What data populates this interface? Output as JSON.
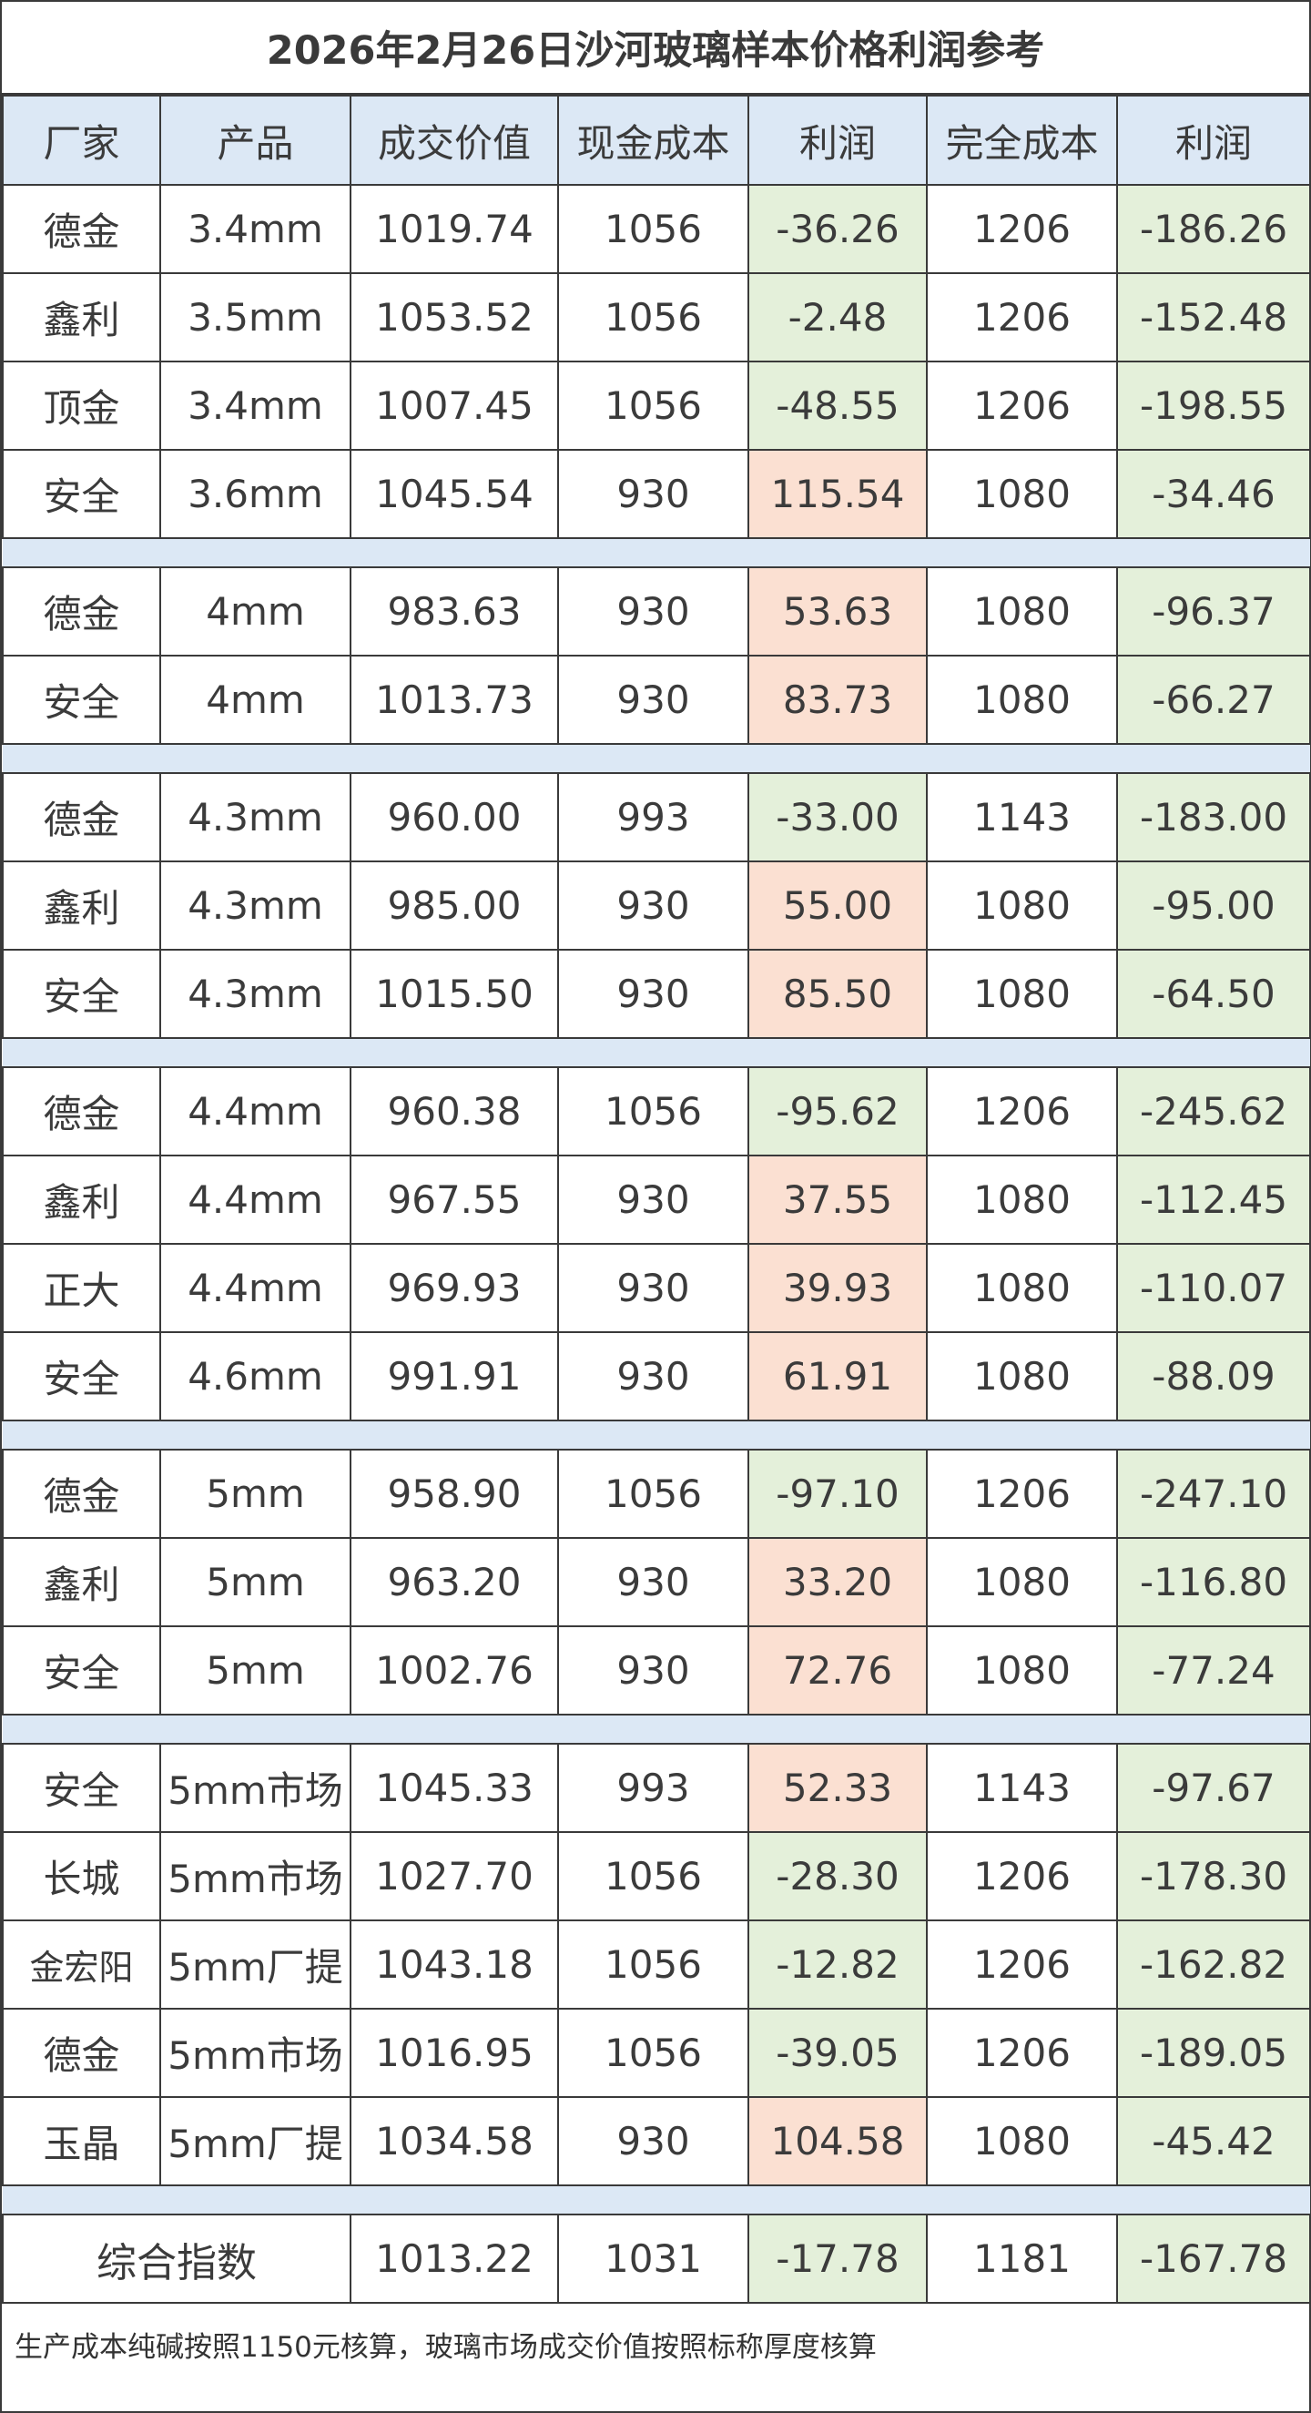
{
  "title": "2026年2月26日沙河玻璃样本价格利润参考",
  "headers": [
    "厂家",
    "产品",
    "成交价值",
    "现金成本",
    "利润",
    "完全成本",
    "利润"
  ],
  "groups": [
    {
      "rows": [
        {
          "factory": "德金",
          "product": "3.4mm",
          "deal_value": "1019.74",
          "cash_cost": "1056",
          "profit": "-36.26",
          "profit_sign": "neg",
          "full_cost": "1206",
          "full_profit": "-186.26"
        },
        {
          "factory": "鑫利",
          "product": "3.5mm",
          "deal_value": "1053.52",
          "cash_cost": "1056",
          "profit": "-2.48",
          "profit_sign": "neg",
          "full_cost": "1206",
          "full_profit": "-152.48"
        },
        {
          "factory": "顶金",
          "product": "3.4mm",
          "deal_value": "1007.45",
          "cash_cost": "1056",
          "profit": "-48.55",
          "profit_sign": "neg",
          "full_cost": "1206",
          "full_profit": "-198.55"
        },
        {
          "factory": "安全",
          "product": "3.6mm",
          "deal_value": "1045.54",
          "cash_cost": "930",
          "profit": "115.54",
          "profit_sign": "pos",
          "full_cost": "1080",
          "full_profit": "-34.46"
        }
      ]
    },
    {
      "rows": [
        {
          "factory": "德金",
          "product": "4mm",
          "deal_value": "983.63",
          "cash_cost": "930",
          "profit": "53.63",
          "profit_sign": "pos",
          "full_cost": "1080",
          "full_profit": "-96.37"
        },
        {
          "factory": "安全",
          "product": "4mm",
          "deal_value": "1013.73",
          "cash_cost": "930",
          "profit": "83.73",
          "profit_sign": "pos",
          "full_cost": "1080",
          "full_profit": "-66.27"
        }
      ]
    },
    {
      "rows": [
        {
          "factory": "德金",
          "product": "4.3mm",
          "deal_value": "960.00",
          "cash_cost": "993",
          "profit": "-33.00",
          "profit_sign": "neg",
          "full_cost": "1143",
          "full_profit": "-183.00"
        },
        {
          "factory": "鑫利",
          "product": "4.3mm",
          "deal_value": "985.00",
          "cash_cost": "930",
          "profit": "55.00",
          "profit_sign": "pos",
          "full_cost": "1080",
          "full_profit": "-95.00"
        },
        {
          "factory": "安全",
          "product": "4.3mm",
          "deal_value": "1015.50",
          "cash_cost": "930",
          "profit": "85.50",
          "profit_sign": "pos",
          "full_cost": "1080",
          "full_profit": "-64.50"
        }
      ]
    },
    {
      "rows": [
        {
          "factory": "德金",
          "product": "4.4mm",
          "deal_value": "960.38",
          "cash_cost": "1056",
          "profit": "-95.62",
          "profit_sign": "neg",
          "full_cost": "1206",
          "full_profit": "-245.62"
        },
        {
          "factory": "鑫利",
          "product": "4.4mm",
          "deal_value": "967.55",
          "cash_cost": "930",
          "profit": "37.55",
          "profit_sign": "pos",
          "full_cost": "1080",
          "full_profit": "-112.45"
        },
        {
          "factory": "正大",
          "product": "4.4mm",
          "deal_value": "969.93",
          "cash_cost": "930",
          "profit": "39.93",
          "profit_sign": "pos",
          "full_cost": "1080",
          "full_profit": "-110.07"
        },
        {
          "factory": "安全",
          "product": "4.6mm",
          "deal_value": "991.91",
          "cash_cost": "930",
          "profit": "61.91",
          "profit_sign": "pos",
          "full_cost": "1080",
          "full_profit": "-88.09"
        }
      ]
    },
    {
      "rows": [
        {
          "factory": "德金",
          "product": "5mm",
          "deal_value": "958.90",
          "cash_cost": "1056",
          "profit": "-97.10",
          "profit_sign": "neg",
          "full_cost": "1206",
          "full_profit": "-247.10"
        },
        {
          "factory": "鑫利",
          "product": "5mm",
          "deal_value": "963.20",
          "cash_cost": "930",
          "profit": "33.20",
          "profit_sign": "pos",
          "full_cost": "1080",
          "full_profit": "-116.80"
        },
        {
          "factory": "安全",
          "product": "5mm",
          "deal_value": "1002.76",
          "cash_cost": "930",
          "profit": "72.76",
          "profit_sign": "pos",
          "full_cost": "1080",
          "full_profit": "-77.24"
        }
      ]
    },
    {
      "rows": [
        {
          "factory": "安全",
          "product": "5mm市场",
          "deal_value": "1045.33",
          "cash_cost": "993",
          "profit": "52.33",
          "profit_sign": "pos",
          "full_cost": "1143",
          "full_profit": "-97.67"
        },
        {
          "factory": "长城",
          "product": "5mm市场",
          "deal_value": "1027.70",
          "cash_cost": "1056",
          "profit": "-28.30",
          "profit_sign": "neg",
          "full_cost": "1206",
          "full_profit": "-178.30"
        },
        {
          "factory": "金宏阳",
          "product": "5mm厂提",
          "deal_value": "1043.18",
          "cash_cost": "1056",
          "profit": "-12.82",
          "profit_sign": "neg",
          "full_cost": "1206",
          "full_profit": "-162.82"
        },
        {
          "factory": "德金",
          "product": "5mm市场",
          "deal_value": "1016.95",
          "cash_cost": "1056",
          "profit": "-39.05",
          "profit_sign": "neg",
          "full_cost": "1206",
          "full_profit": "-189.05"
        },
        {
          "factory": "玉晶",
          "product": "5mm厂提",
          "deal_value": "1034.58",
          "cash_cost": "930",
          "profit": "104.58",
          "profit_sign": "pos",
          "full_cost": "1080",
          "full_profit": "-45.42"
        }
      ]
    }
  ],
  "summary": {
    "label": "综合指数",
    "deal_value": "1013.22",
    "cash_cost": "1031",
    "profit": "-17.78",
    "profit_sign": "neg",
    "full_cost": "1181",
    "full_profit": "-167.78"
  },
  "footnote": "生产成本纯碱按照1150元核算，玻璃市场成交价值按照标称厚度核算",
  "colors": {
    "header_bg": "#dce8f5",
    "negative_bg": "#e4f0da",
    "positive_bg": "#fbe0d2",
    "border": "#3a3a3a"
  }
}
